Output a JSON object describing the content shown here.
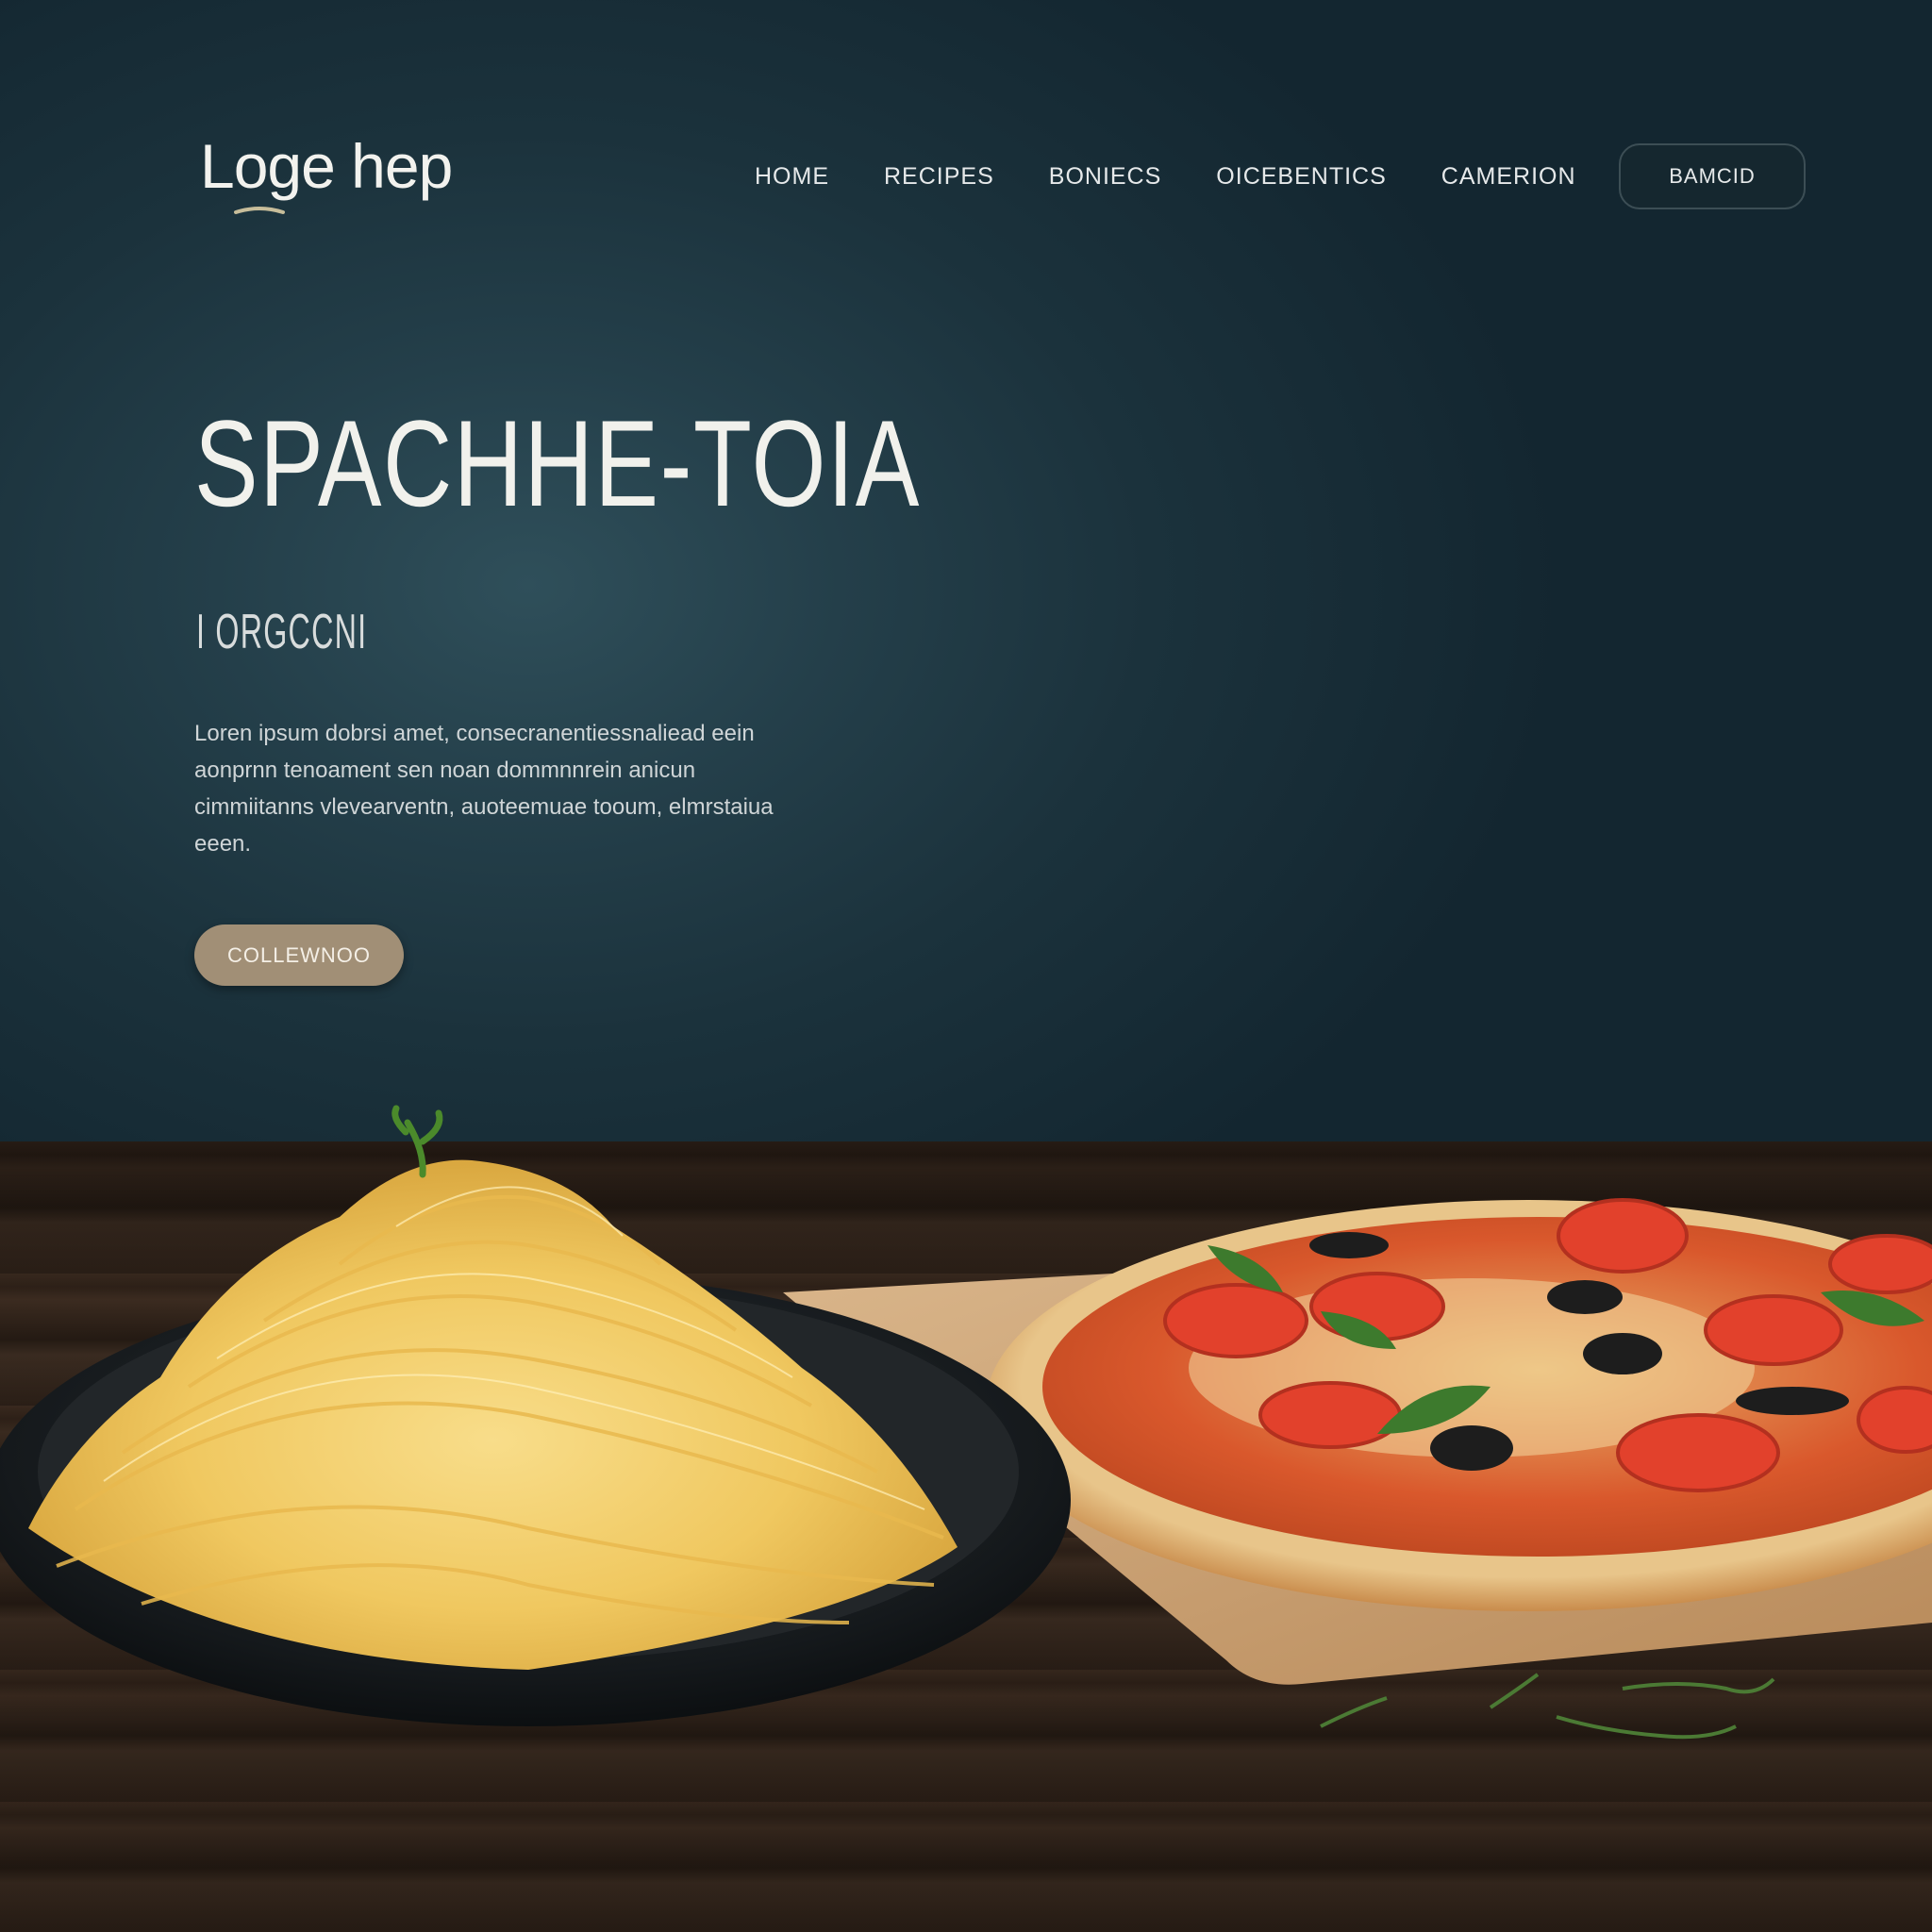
{
  "brand": {
    "logo": "Loge hep"
  },
  "nav": {
    "items": [
      "HOME",
      "RECIPES",
      "BONIECS",
      "OICEBENTICS",
      "CAMERION"
    ],
    "cta_label": "BAMCID"
  },
  "hero": {
    "headline": "SPACHHE-TOIA",
    "subhead": "I ORGCCNI",
    "body": "Loren ipsum dobrsi amet, consecranentiessnaliead eein aonprnn tenoament sen noan dommnnrein anicun cimmiitanns vlevearventn, auoteemuae tooum, elmrstaiua eeen.",
    "cta_label": "COLLEWNOO"
  },
  "colors": {
    "hero_bg": "#1f3a44",
    "accent_button": "#a18f76",
    "text": "#f1f1ec"
  },
  "images": {
    "spaghetti": "spaghetti-plate-image",
    "pizza": "pizza-on-board-image"
  }
}
